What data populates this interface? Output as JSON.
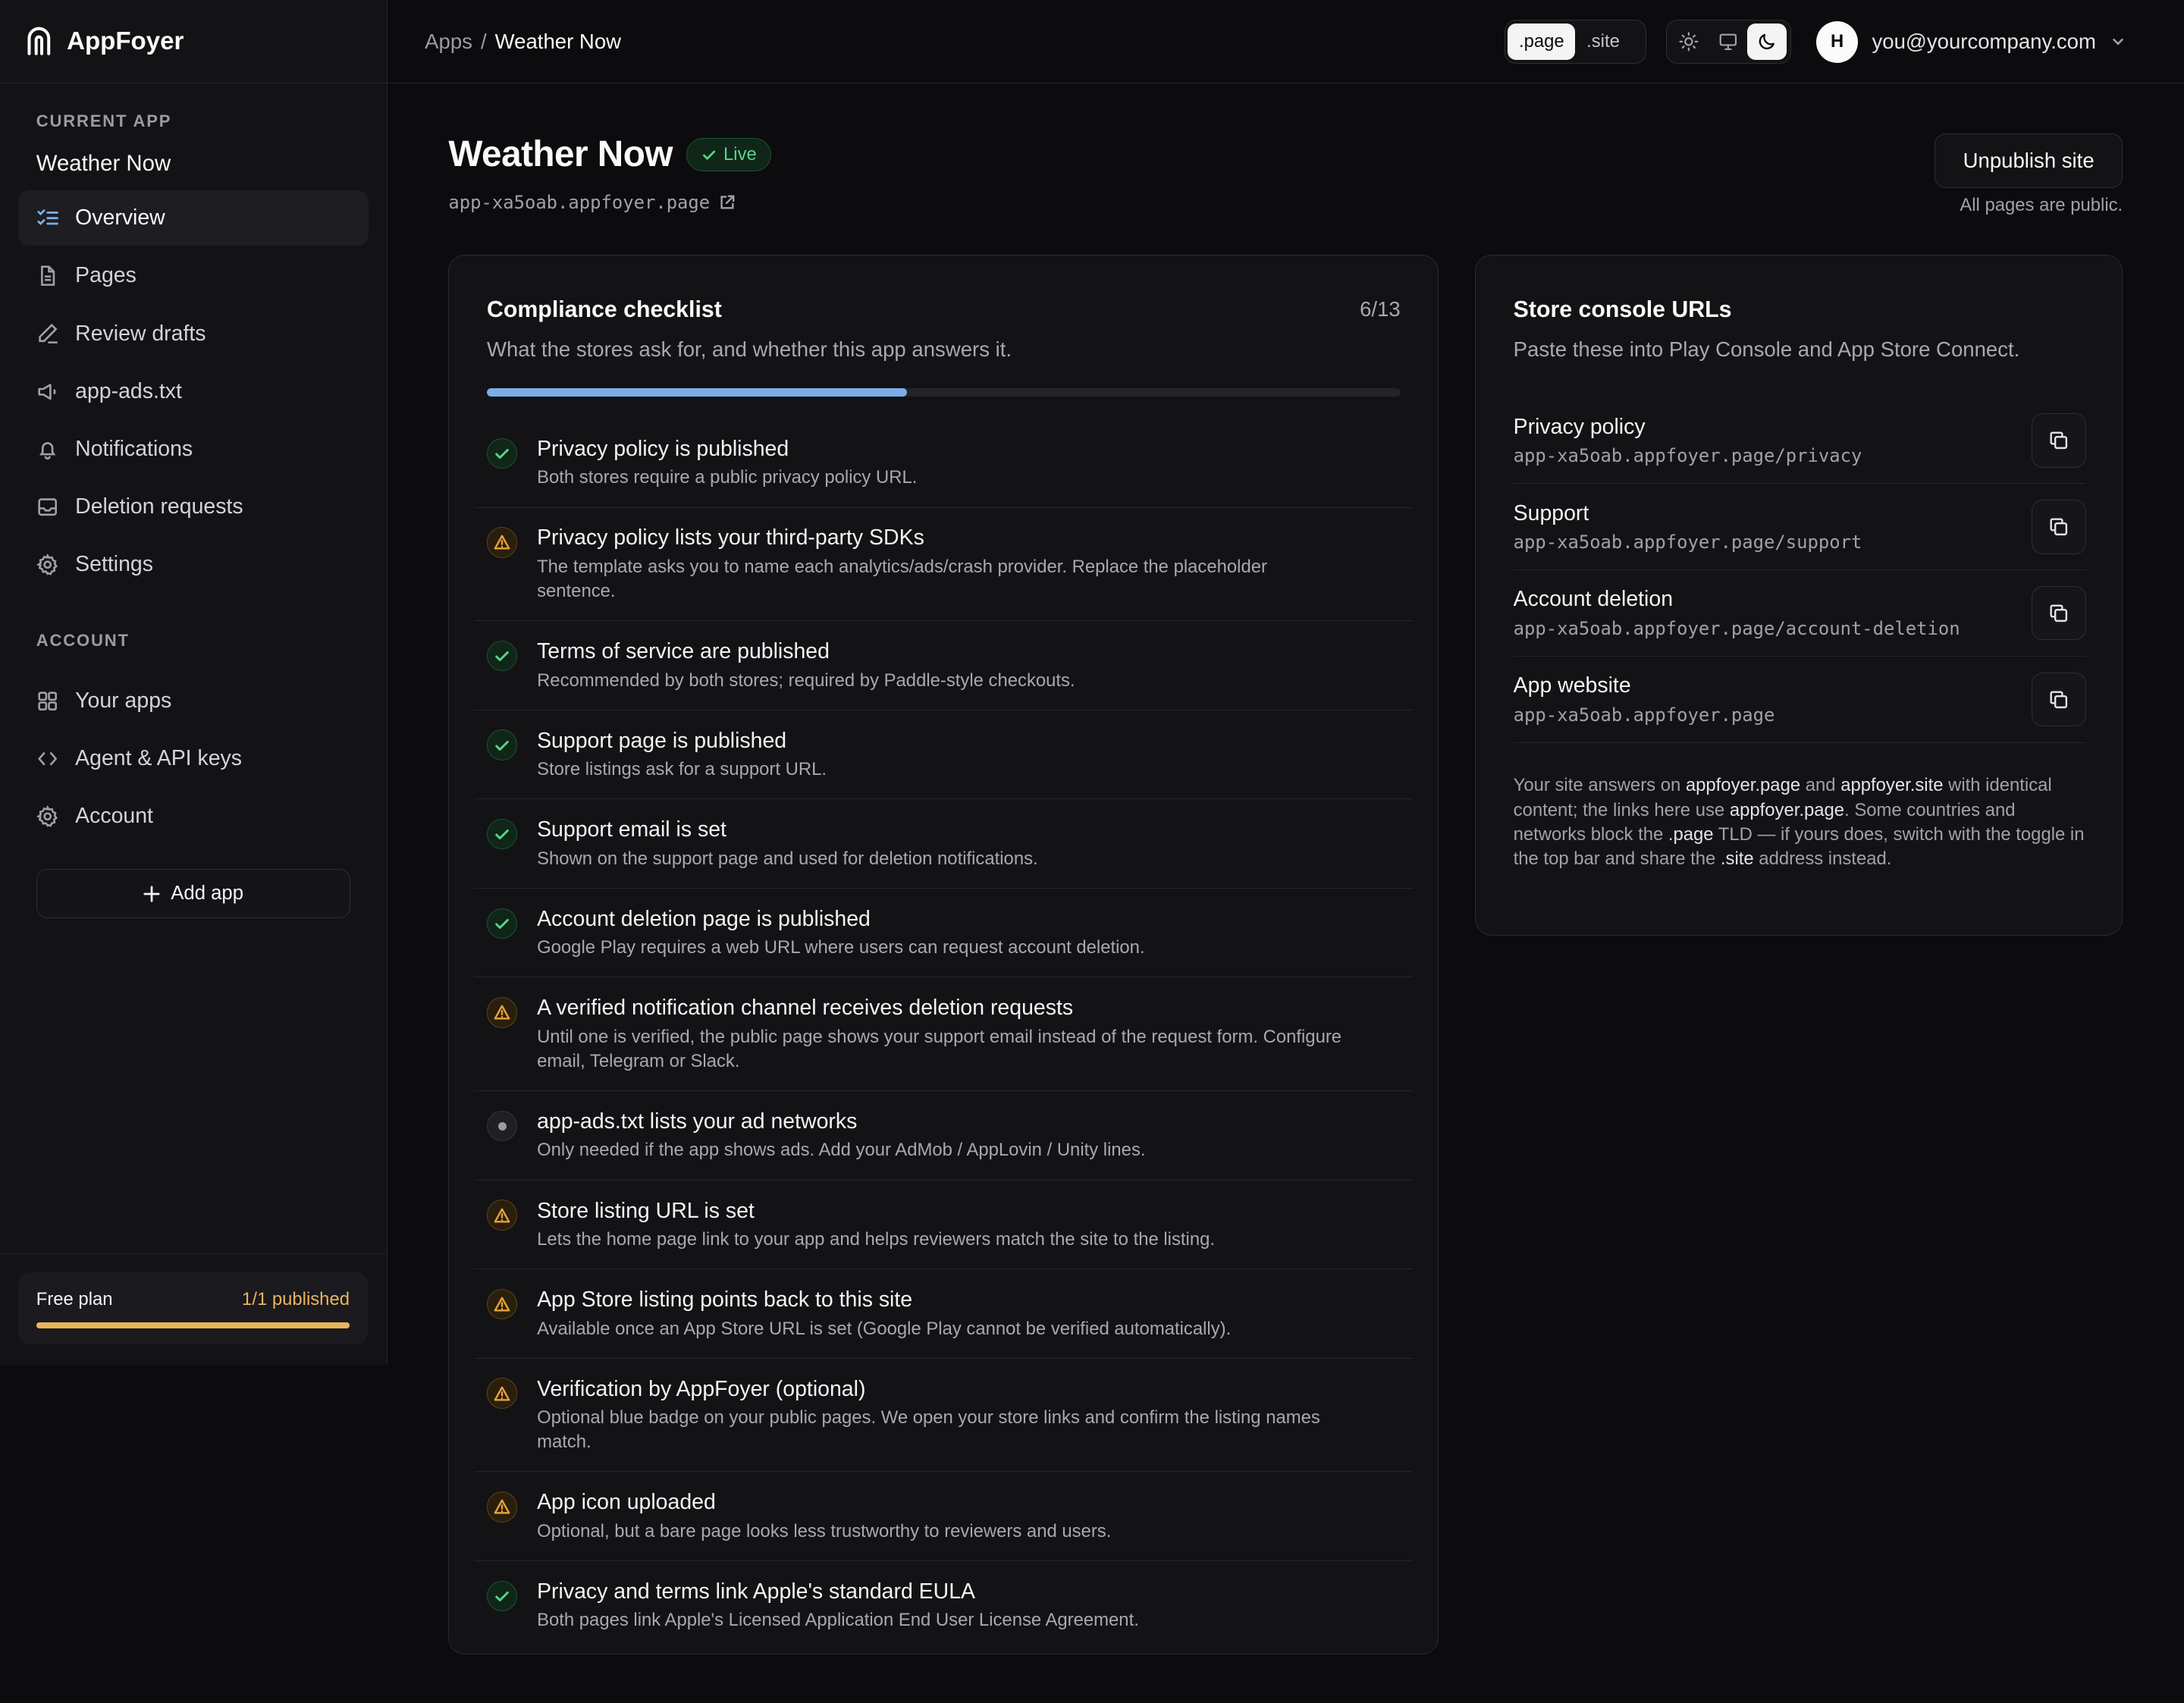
{
  "brand": {
    "name": "AppFoyer"
  },
  "sidebar": {
    "current_app_label": "CURRENT APP",
    "current_app_name": "Weather Now",
    "app_items": [
      {
        "label": "Overview",
        "icon": "list-checks-icon",
        "active": true
      },
      {
        "label": "Pages",
        "icon": "file-icon"
      },
      {
        "label": "Review drafts",
        "icon": "pen-icon"
      },
      {
        "label": "app-ads.txt",
        "icon": "megaphone-icon"
      },
      {
        "label": "Notifications",
        "icon": "bell-icon"
      },
      {
        "label": "Deletion requests",
        "icon": "inbox-icon"
      },
      {
        "label": "Settings",
        "icon": "gear-icon"
      }
    ],
    "account_label": "ACCOUNT",
    "account_items": [
      {
        "label": "Your apps",
        "icon": "grid-icon"
      },
      {
        "label": "Agent & API keys",
        "icon": "code-icon"
      },
      {
        "label": "Account",
        "icon": "gear-icon"
      }
    ],
    "add_app_label": "Add app",
    "plan": {
      "name": "Free plan",
      "usage": "1/1 published",
      "fraction": 1.0,
      "color": "#e9b45a"
    }
  },
  "topbar": {
    "breadcrumb_root": "Apps",
    "breadcrumb_sep": "/",
    "breadcrumb_current": "Weather Now",
    "tld_options": [
      ".page",
      ".site"
    ],
    "tld_selected": ".page",
    "theme_options": [
      "sun-icon",
      "monitor-icon",
      "moon-icon"
    ],
    "theme_selected": "moon-icon",
    "user_initial": "H",
    "user_email": "you@yourcompany.com"
  },
  "header": {
    "title": "Weather Now",
    "status": "Live",
    "domain": "app-xa5oab.appfoyer.page",
    "unpublish_label": "Unpublish site",
    "public_note": "All pages are public."
  },
  "checklist": {
    "title": "Compliance checklist",
    "subtitle": "What the stores ask for, and whether this app answers it.",
    "count": "6/13",
    "progress": 0.46,
    "items": [
      {
        "status": "ok",
        "title": "Privacy policy is published",
        "desc": "Both stores require a public privacy policy URL."
      },
      {
        "status": "warn",
        "title": "Privacy policy lists your third-party SDKs",
        "desc": "The template asks you to name each analytics/ads/crash provider. Replace the placeholder sentence."
      },
      {
        "status": "ok",
        "title": "Terms of service are published",
        "desc": "Recommended by both stores; required by Paddle-style checkouts."
      },
      {
        "status": "ok",
        "title": "Support page is published",
        "desc": "Store listings ask for a support URL."
      },
      {
        "status": "ok",
        "title": "Support email is set",
        "desc": "Shown on the support page and used for deletion notifications."
      },
      {
        "status": "ok",
        "title": "Account deletion page is published",
        "desc": "Google Play requires a web URL where users can request account deletion."
      },
      {
        "status": "warn",
        "title": "A verified notification channel receives deletion requests",
        "desc": "Until one is verified, the public page shows your support email instead of the request form. Configure email, Telegram or Slack."
      },
      {
        "status": "na",
        "title": "app-ads.txt lists your ad networks",
        "desc": "Only needed if the app shows ads. Add your AdMob / AppLovin / Unity lines."
      },
      {
        "status": "warn",
        "title": "Store listing URL is set",
        "desc": "Lets the home page link to your app and helps reviewers match the site to the listing."
      },
      {
        "status": "warn",
        "title": "App Store listing points back to this site",
        "desc": "Available once an App Store URL is set (Google Play cannot be verified automatically)."
      },
      {
        "status": "warn",
        "title": "Verification by AppFoyer (optional)",
        "desc": "Optional blue badge on your public pages. We open your store links and confirm the listing names match."
      },
      {
        "status": "warn",
        "title": "App icon uploaded",
        "desc": "Optional, but a bare page looks less trustworthy to reviewers and users."
      },
      {
        "status": "ok",
        "title": "Privacy and terms link Apple's standard EULA",
        "desc": "Both pages link Apple's Licensed Application End User License Agreement."
      }
    ]
  },
  "urls": {
    "title": "Store console URLs",
    "subtitle": "Paste these into Play Console and App Store Connect.",
    "items": [
      {
        "label": "Privacy policy",
        "value": "app-xa5oab.appfoyer.page/privacy"
      },
      {
        "label": "Support",
        "value": "app-xa5oab.appfoyer.page/support"
      },
      {
        "label": "Account deletion",
        "value": "app-xa5oab.appfoyer.page/account-deletion"
      },
      {
        "label": "App website",
        "value": "app-xa5oab.appfoyer.page"
      }
    ],
    "note": {
      "p1": "Your site answers on ",
      "b1": "appfoyer.page",
      "p2": " and ",
      "b2": "appfoyer.site",
      "p3": " with identical content; the links here use ",
      "b3": "appfoyer.page",
      "p4": ". Some countries and networks block the ",
      "b4": ".page",
      "p5": " TLD — if yours does, switch with the toggle in the top bar and share the ",
      "b5": ".site",
      "p6": " address instead."
    }
  },
  "colors": {
    "accent_progress": "#7aaee8",
    "ok": "#5bd38a",
    "warn": "#e9a23b"
  }
}
